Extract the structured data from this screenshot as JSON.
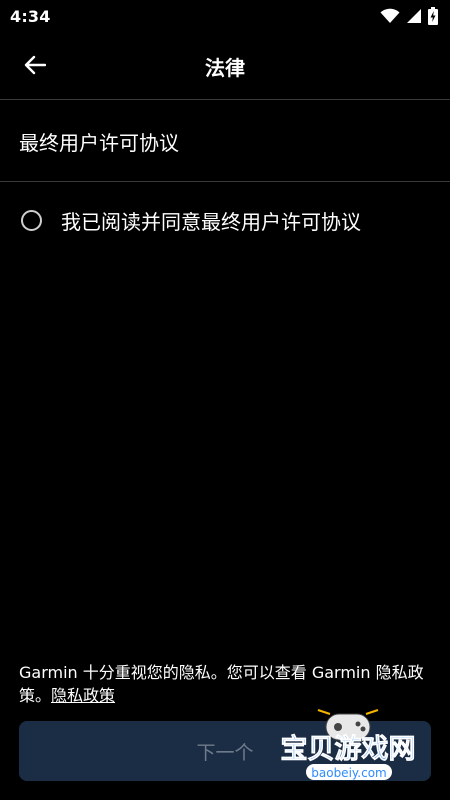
{
  "status_bar": {
    "time": "4:34",
    "icons": [
      "wifi-icon",
      "signal-icon",
      "battery-charging-icon"
    ]
  },
  "appbar": {
    "title": "法律",
    "back_icon": "arrow-left-icon"
  },
  "eula_item": {
    "label": "最终用户许可协议"
  },
  "agreement": {
    "label": "我已阅读并同意最终用户许可协议",
    "checked": false
  },
  "privacy_notice": {
    "text": "Garmin 十分重视您的隐私。您可以查看 Garmin 隐私政策。",
    "link": "隐私政策"
  },
  "next_button": {
    "label": "下一个",
    "enabled": false
  },
  "watermark": {
    "title": "宝贝游戏网",
    "url": "baobeiy.com"
  },
  "colors": {
    "background": "#000000",
    "divider": "#3a3a3a",
    "button_bg": "#1b2d45",
    "button_text_disabled": "#6f7b8a",
    "watermark_text": "#2f8cff"
  }
}
